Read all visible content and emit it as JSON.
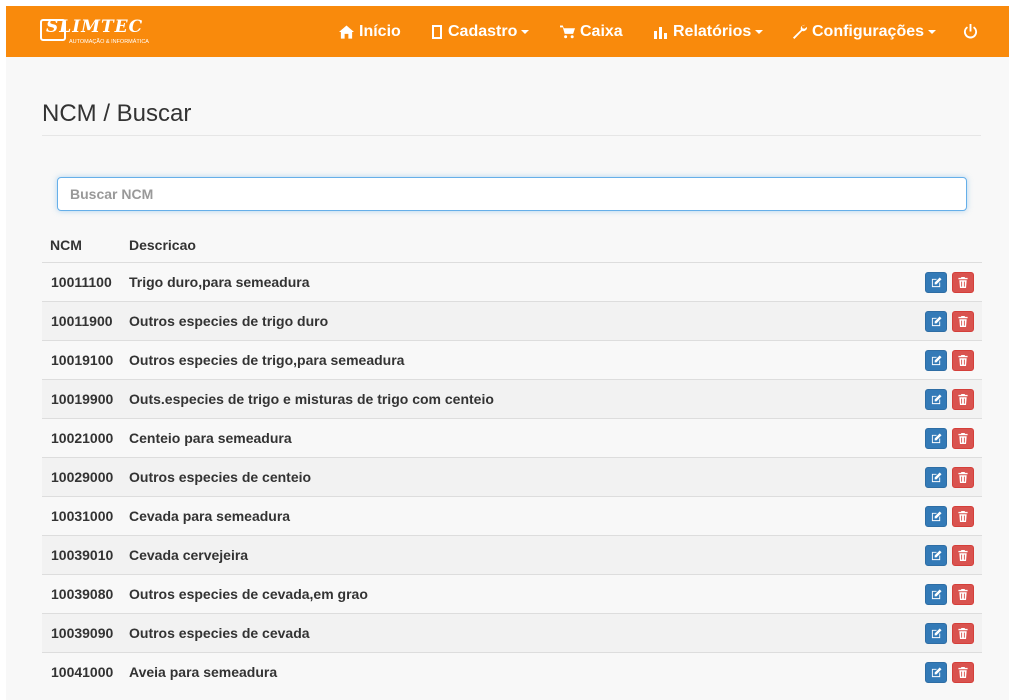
{
  "brand": {
    "name": "SLIMTEC",
    "tagline": "AUTOMAÇÃO & INFORMÁTICA"
  },
  "nav": {
    "home": "Início",
    "cadastro": "Cadastro",
    "caixa": "Caixa",
    "relatorios": "Relatórios",
    "configuracoes": "Configurações"
  },
  "page": {
    "title": "NCM / Buscar"
  },
  "search": {
    "placeholder": "Buscar NCM",
    "value": ""
  },
  "table": {
    "headers": {
      "ncm": "NCM",
      "descricao": "Descricao"
    },
    "rows": [
      {
        "ncm": "10011100",
        "descricao": "Trigo duro,para semeadura"
      },
      {
        "ncm": "10011900",
        "descricao": "Outros especies de trigo duro"
      },
      {
        "ncm": "10019100",
        "descricao": "Outros especies de trigo,para semeadura"
      },
      {
        "ncm": "10019900",
        "descricao": "Outs.especies de trigo e misturas de trigo com centeio"
      },
      {
        "ncm": "10021000",
        "descricao": "Centeio para semeadura"
      },
      {
        "ncm": "10029000",
        "descricao": "Outros especies de centeio"
      },
      {
        "ncm": "10031000",
        "descricao": "Cevada para semeadura"
      },
      {
        "ncm": "10039010",
        "descricao": "Cevada cervejeira"
      },
      {
        "ncm": "10039080",
        "descricao": "Outros especies de cevada,em grao"
      },
      {
        "ncm": "10039090",
        "descricao": "Outros especies de cevada"
      },
      {
        "ncm": "10041000",
        "descricao": "Aveia para semeadura"
      }
    ]
  },
  "colors": {
    "navbar": "#f98a0c",
    "edit": "#337ab7",
    "delete": "#d9534f"
  },
  "icons": {
    "home": "home-icon",
    "cadastro": "book-icon",
    "caixa": "cart-icon",
    "relatorios": "bar-chart-icon",
    "configuracoes": "wrench-icon",
    "logout": "power-icon",
    "edit": "edit-icon",
    "delete": "trash-icon"
  }
}
